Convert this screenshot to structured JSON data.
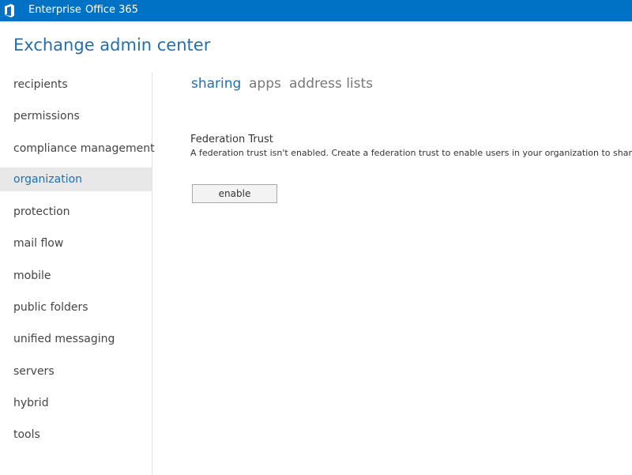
{
  "topbar": {
    "logo_icon": "office-logo-icon",
    "links": [
      "Enterprise",
      "Office 365"
    ],
    "background": "#0072c6"
  },
  "app_title": "Exchange admin center",
  "sidebar": {
    "items": [
      {
        "label": "recipients",
        "active": false
      },
      {
        "label": "permissions",
        "active": false
      },
      {
        "label": "compliance management",
        "active": false
      },
      {
        "label": "organization",
        "active": true
      },
      {
        "label": "protection",
        "active": false
      },
      {
        "label": "mail flow",
        "active": false
      },
      {
        "label": "mobile",
        "active": false
      },
      {
        "label": "public folders",
        "active": false
      },
      {
        "label": "unified messaging",
        "active": false
      },
      {
        "label": "servers",
        "active": false
      },
      {
        "label": "hybrid",
        "active": false
      },
      {
        "label": "tools",
        "active": false
      }
    ]
  },
  "tabs": [
    {
      "label": "sharing",
      "active": true
    },
    {
      "label": "apps",
      "active": false
    },
    {
      "label": "address lists",
      "active": false
    }
  ],
  "federation": {
    "title": "Federation Trust",
    "description": "A federation trust isn't enabled. Create a federation trust to enable users in your organization to share calen",
    "button_label": "enable"
  },
  "colors": {
    "accent": "#1f6fb2",
    "active_nav_bg": "#e8e8e8"
  }
}
